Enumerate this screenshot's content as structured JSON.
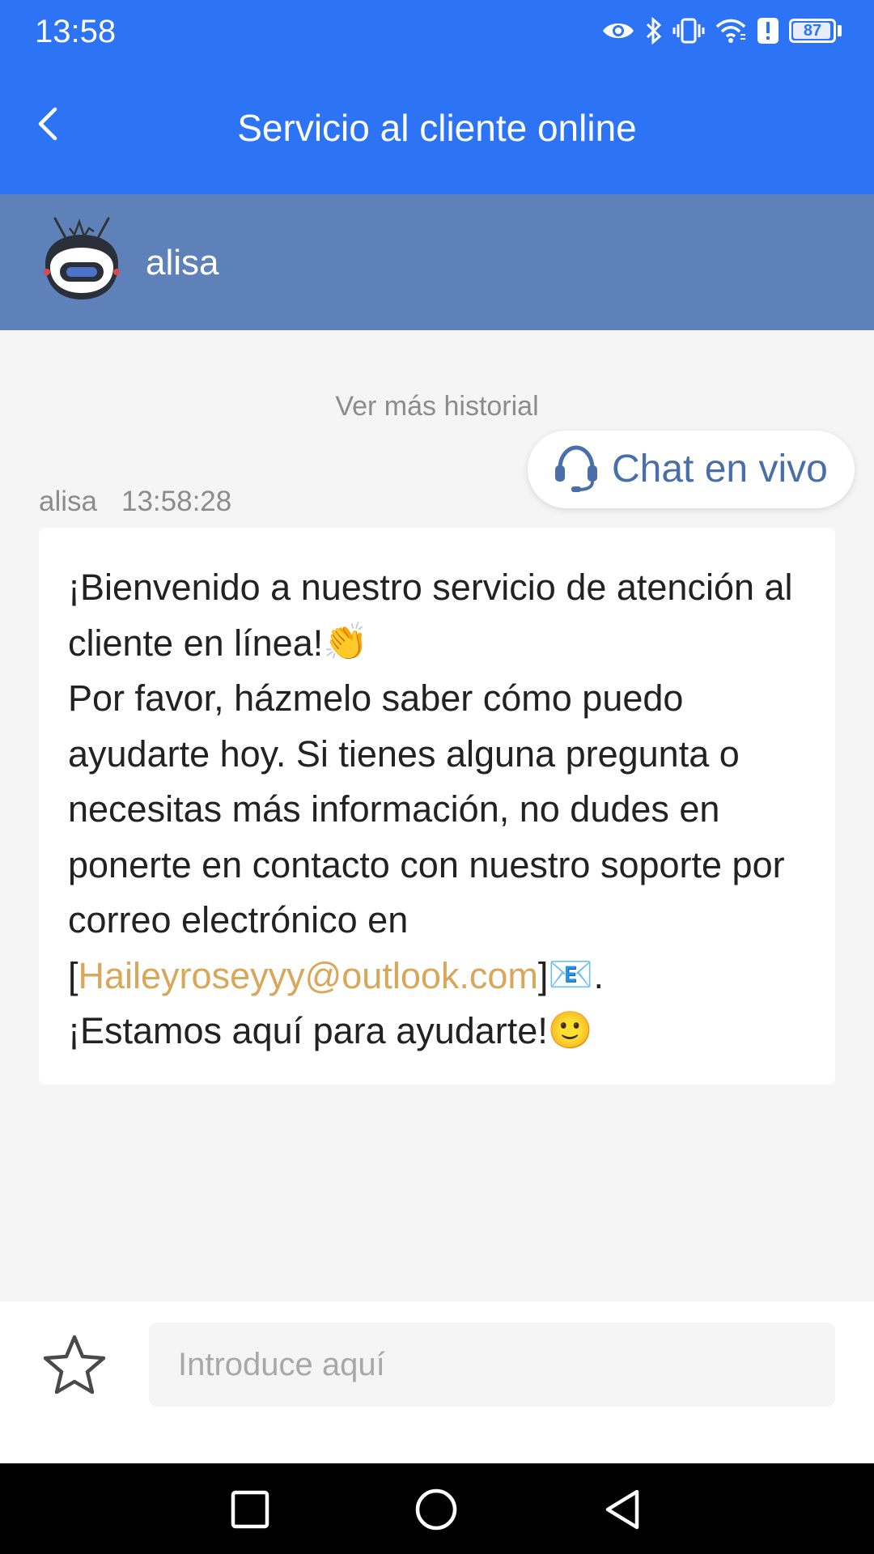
{
  "status_bar": {
    "time": "13:58",
    "battery_level": "87",
    "icons": [
      "eye-icon",
      "bluetooth-icon",
      "vibrate-icon",
      "wifi-icon",
      "alert-icon",
      "battery-icon"
    ]
  },
  "header": {
    "title": "Servicio al cliente online",
    "back_icon": "chevron-left-icon"
  },
  "agent": {
    "name": "alisa",
    "avatar_icon": "robot-avatar-icon"
  },
  "chat": {
    "history_link": "Ver más historial",
    "live_chat_label": "Chat en vivo",
    "live_chat_icon": "headset-icon",
    "message": {
      "sender": "alisa",
      "time": "13:58:28",
      "line1": "¡Bienvenido a nuestro servicio de atención al cliente en línea!",
      "line1_emoji": "👏",
      "line2": "Por favor, házmelo saber cómo puedo ayudarte hoy. Si tienes alguna pregunta o necesitas más información, no dudes en ponerte en contacto con nuestro soporte por correo electrónico en",
      "open_bracket": "[",
      "email": "Haileyroseyyy@outlook.com",
      "close_bracket": "]",
      "email_emoji": "📧",
      "period": ".",
      "line3": "¡Estamos aquí para ayudarte!",
      "line3_emoji": "🙂"
    }
  },
  "input": {
    "placeholder": "Introduce aquí",
    "value": "",
    "star_icon": "star-icon"
  },
  "system_nav": {
    "buttons": [
      "recent-apps-icon",
      "home-icon",
      "back-icon"
    ]
  },
  "colors": {
    "primary": "#2c74f5",
    "agent_bar": "#5f81b9",
    "link": "#d8a75a",
    "live_chat_text": "#4a6fa8"
  }
}
